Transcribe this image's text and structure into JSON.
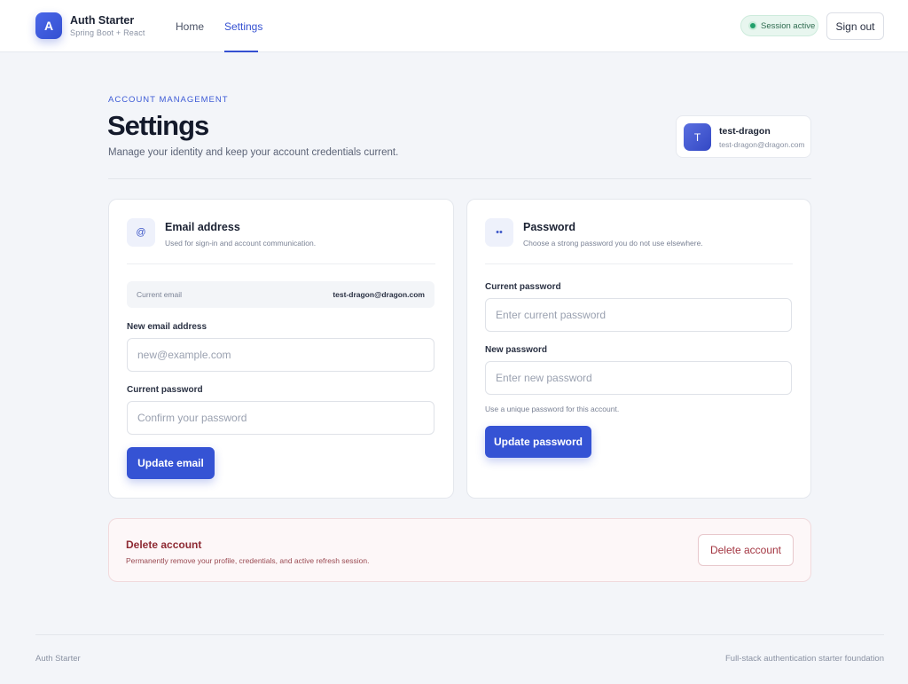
{
  "header": {
    "logo_letter": "A",
    "app_name": "Auth Starter",
    "app_sub": "Spring Boot + React",
    "nav": [
      {
        "label": "Home",
        "active": false
      },
      {
        "label": "Settings",
        "active": true
      }
    ],
    "session_label": "Session active",
    "signout_label": "Sign out"
  },
  "page": {
    "eyebrow": "ACCOUNT MANAGEMENT",
    "title": "Settings",
    "subtitle": "Manage your identity and keep your account credentials current."
  },
  "user": {
    "avatar_letter": "T",
    "name": "test-dragon",
    "email": "test-dragon@dragon.com"
  },
  "email_card": {
    "icon": "@",
    "title": "Email address",
    "description": "Used for sign-in and account communication.",
    "current_label": "Current email",
    "current_value": "test-dragon@dragon.com",
    "new_label": "New email address",
    "new_placeholder": "new@example.com",
    "password_label": "Current password",
    "password_placeholder": "Confirm your password",
    "submit_label": "Update email"
  },
  "password_card": {
    "icon": "••",
    "title": "Password",
    "description": "Choose a strong password you do not use elsewhere.",
    "current_label": "Current password",
    "current_placeholder": "Enter current password",
    "new_label": "New password",
    "new_placeholder": "Enter new password",
    "hint": "Use a unique password for this account.",
    "submit_label": "Update password"
  },
  "danger": {
    "title": "Delete account",
    "description": "Permanently remove your profile, credentials, and active refresh session.",
    "button_label": "Delete account"
  },
  "footer": {
    "left": "Auth Starter",
    "right": "Full-stack authentication starter foundation"
  },
  "colors": {
    "accent": "#3553d4",
    "success": "#22a06b",
    "danger": "#a33541"
  }
}
